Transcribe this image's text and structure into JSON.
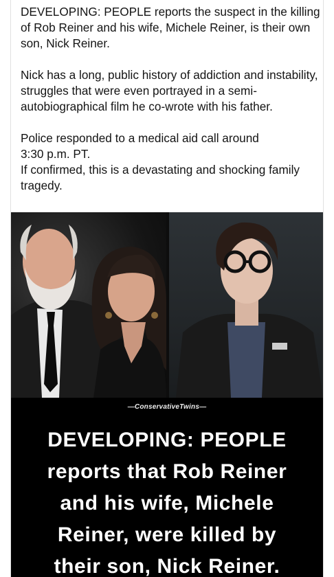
{
  "post": {
    "paragraphs": [
      "DEVELOPING: PEOPLE reports the suspect in the killing of Rob Reiner and his wife, Michele Reiner, is their own son, Nick Reiner.",
      "Nick has a long, public history of addiction and instability, struggles that were even portrayed in a semi-autobiographical film he co-wrote with his father.",
      "Police responded to a medical aid call around\n3:30 p.m. PT.\nIf confirmed, this is a devastating and shocking family tragedy."
    ]
  },
  "image": {
    "watermark": "—ConservativeTwins—",
    "headline_lines": [
      "DEVELOPING: PEOPLE",
      "reports that Rob Reiner",
      "and his wife, Michele",
      "Reiner, were killed by",
      "their son, Nick Reiner."
    ],
    "colors": {
      "background": "#000000",
      "headline": "#ffffff"
    }
  }
}
